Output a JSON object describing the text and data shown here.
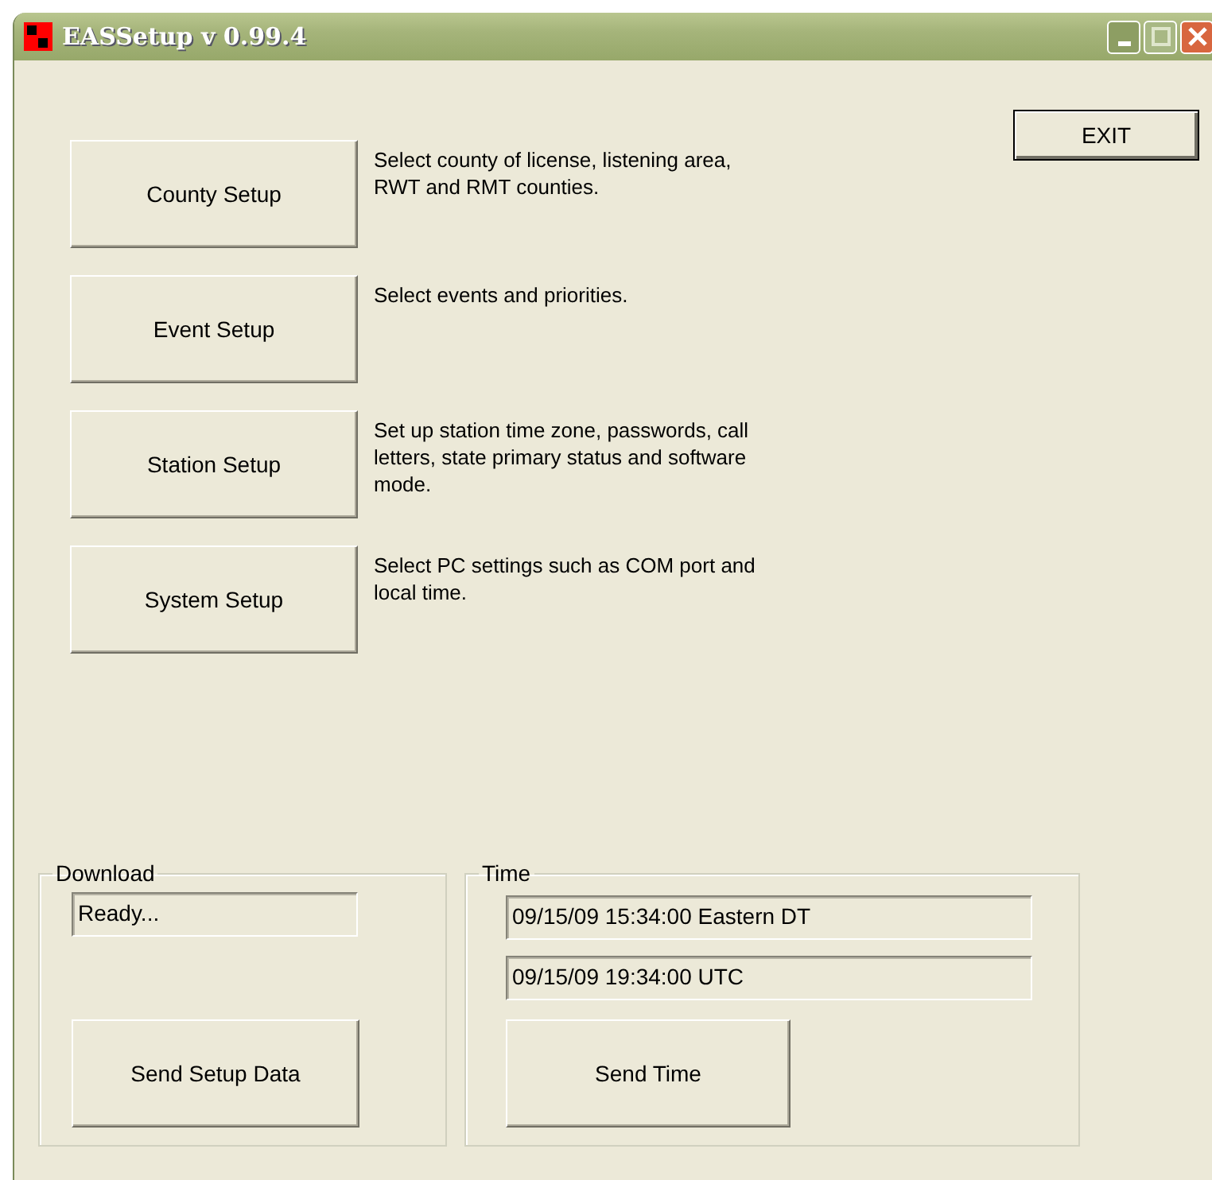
{
  "window": {
    "title": "EASSetup v 0.99.4"
  },
  "exit_button": "EXIT",
  "setup_items": [
    {
      "button": "County Setup",
      "description": "Select county of license, listening area, RWT and RMT counties."
    },
    {
      "button": "Event Setup",
      "description": "Select events and priorities."
    },
    {
      "button": "Station Setup",
      "description": "Set up station time zone, passwords, call letters, state primary status and software mode."
    },
    {
      "button": "System Setup",
      "description": "Select PC settings such as COM port and local time."
    }
  ],
  "download": {
    "title": "Download",
    "status": "Ready...",
    "button": "Send Setup Data"
  },
  "time": {
    "title": "Time",
    "fields": [
      "09/15/09 15:34:00  Eastern DT",
      "09/15/09 19:34:00  UTC"
    ],
    "button": "Send Time"
  }
}
